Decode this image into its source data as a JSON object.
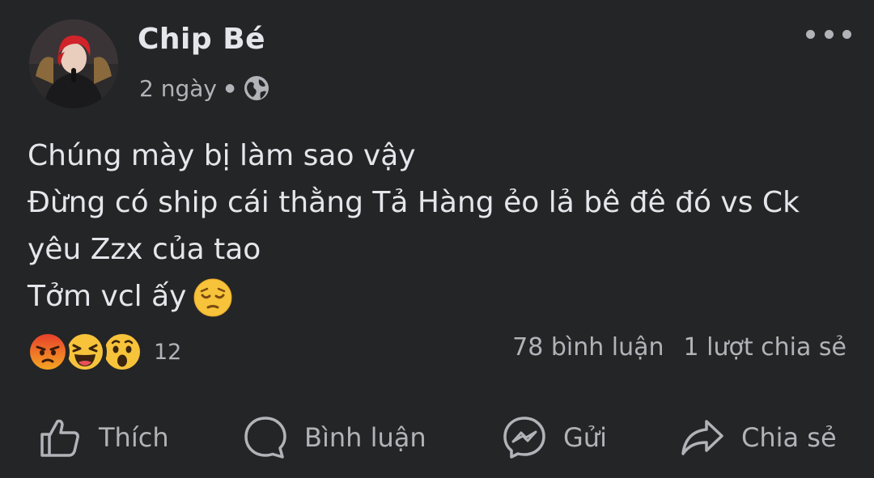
{
  "post": {
    "author": "Chip Bé",
    "time": "2 ngày",
    "privacy_icon": "globe-icon",
    "more_icon": "more-horizontal-icon",
    "text_lines": [
      "Chúng mày bị làm sao vậy",
      "Đừng có ship cái thằng Tả Hàng ẻo lả bê đê đó vs Ck",
      "yêu Zzx của tao",
      "Tởm vcl ấy"
    ],
    "inline_emoji": "pensive-face"
  },
  "reactions": {
    "types": [
      "angry",
      "haha",
      "wow"
    ],
    "count": "12"
  },
  "stats": {
    "comments": "78 bình luận",
    "shares": "1 lượt chia sẻ"
  },
  "actions": {
    "like": "Thích",
    "comment": "Bình luận",
    "send": "Gửi",
    "share": "Chia sẻ"
  },
  "colors": {
    "background": "#242526",
    "primary_text": "#e4e6eb",
    "secondary_text": "#b0b3b8"
  }
}
